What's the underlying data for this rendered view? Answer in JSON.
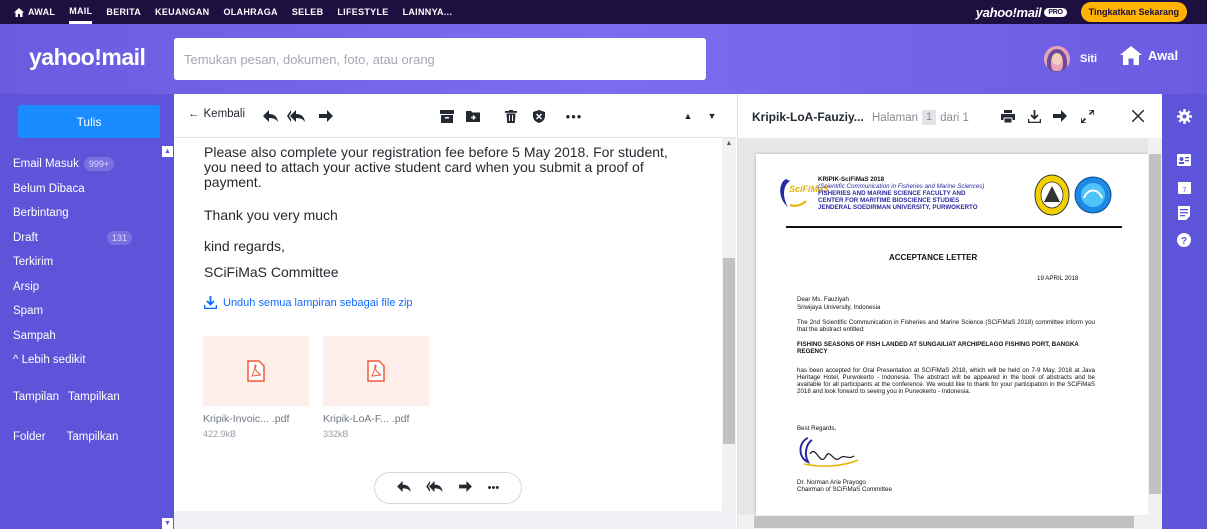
{
  "topnav": {
    "items": [
      "AWAL",
      "MAIL",
      "BERITA",
      "KEUANGAN",
      "OLAHRAGA",
      "SELEB",
      "LIFESTYLE",
      "LAINNYA..."
    ],
    "active_index": 1,
    "brand": "yahoo!mail",
    "brand_badge": "PRO",
    "upgrade_label": "Tingkatkan Sekarang"
  },
  "header": {
    "logo": "yahoo!mail",
    "search_placeholder": "Temukan pesan, dokumen, foto, atau orang",
    "user_name": "Siti",
    "home_label": "Awal"
  },
  "sidebar": {
    "compose_label": "Tulis",
    "folders": [
      {
        "label": "Email Masuk",
        "badge": "999+"
      },
      {
        "label": "Belum Dibaca",
        "badge": ""
      },
      {
        "label": "Berbintang",
        "badge": ""
      },
      {
        "label": "Draft",
        "badge": "131"
      },
      {
        "label": "Terkirim",
        "badge": ""
      },
      {
        "label": "Arsip",
        "badge": ""
      },
      {
        "label": "Spam",
        "badge": ""
      },
      {
        "label": "Sampah",
        "badge": ""
      },
      {
        "label": "^ Lebih sedikit",
        "badge": ""
      }
    ],
    "views_label": "Tampilan",
    "views_action": "Tampilkan",
    "folder_label": "Folder",
    "folder_action": "Tampilkan"
  },
  "mail": {
    "back_label": "Kembali",
    "paragraphs": [
      "Please also complete your registration fee before 5 May 2018. For student, you need to attach your active student card when you submit a proof of payment.",
      "Thank you very much",
      "kind regards,",
      "SCiFiMaS Committee"
    ],
    "download_all_label": "Unduh semua lampiran sebagai file zip",
    "attachments": [
      {
        "name": "Kripik-Invoic... .pdf",
        "size": "422.9kB"
      },
      {
        "name": "Kripik-LoA-F... .pdf",
        "size": "332kB"
      }
    ]
  },
  "preview": {
    "title": "Kripik-LoA-Fauziy...",
    "page_label": "Halaman",
    "page_current": "1",
    "page_of": "dari 1",
    "doc": {
      "logo_text": "SciFiMaS",
      "header_lines": [
        "KRIPIK-SciFiMaS 2018",
        "(Scientific Communication in Fisheries and Marine Sciences)",
        "FISHERIES AND MARINE SCIENCE FACULTY AND",
        "CENTER FOR MARITIME BIOSCIENCE STUDIES",
        "JENDERAL SOEDIRMAN UNIVERSITY, PURWOKERTO"
      ],
      "title": "ACCEPTANCE LETTER",
      "date": "19 APRIL 2018",
      "salutation": "Dear Ms. Fauziyah",
      "affiliation": "Sriwijaya University, Indonesia",
      "intro": "The 2nd Scientific Communication in Fisheries and Marine Science (SCiFiMaS 2018) committee inform you that the abstract entitled:",
      "paper_title": "FISHING SEASONS OF FISH LANDED AT SUNGAILIAT ARCHIPELAGO FISHING PORT, BANGKA REGENCY",
      "body": "has been accepted for Oral Presentation at SCiFiMaS 2018, which will be held on 7-9 May, 2018 at Java Heritage Hotel, Purwokerto - Indonesia. The abstract will be appeared in the book of abstracts and be available for all participants at the conference. We would like to thank for your participation in the SCiFiMaS 2018 and look forward to seeing you in Purwokerto - Indonesia.",
      "regards": "Best Regards,",
      "signer": "Dr. Norman Arie Prayogo",
      "signer_role": "Chairman of SCiFiMaS Committee"
    }
  },
  "colors": {
    "topnav_bg": "#1d0f3f",
    "header_bg": "#6b5be0",
    "sidebar_bg": "#5e54d9",
    "compose_bg": "#1a8cff",
    "upgrade_bg": "#ffb200",
    "link": "#0f69ff"
  }
}
